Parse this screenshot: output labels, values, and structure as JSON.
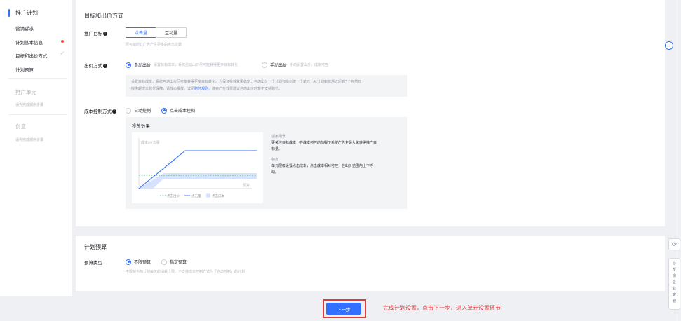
{
  "sidebar": {
    "section1": {
      "title": "推广计划",
      "items": [
        "营销诉求",
        "计划基本信息",
        "目标和出价方式",
        "计划预算"
      ]
    },
    "section2": {
      "title": "推广单元",
      "hint": "请先完成顺序步骤"
    },
    "section3": {
      "title": "创意",
      "hint": "请先完成顺序步骤"
    }
  },
  "objective": {
    "section_title": "目标和出价方式",
    "goal_label": "推广目标",
    "goal_options": [
      "点击量",
      "互动量"
    ],
    "goal_selected": "点击量",
    "goal_hint": "尽可能的让广告产生更多的点击次数",
    "bid_label": "出价方式",
    "bid_options": [
      {
        "label": "自动出价",
        "sub": "设置目标成本，系统自动出价尽可能获得更多目标转化",
        "selected": true
      },
      {
        "label": "手动出价",
        "sub": "手动设置出价，成本可控",
        "selected": false
      }
    ],
    "bid_desc_1": "设置目标成本，系统自动出价尽可能获得更多目标转化。为保证投放效果稳定，自动出价一个计划只能创建一个单元，从计划审核通过起到7个自然日",
    "bid_desc_2a": "提供超成本赔付保障，请放心投放。详见",
    "bid_desc_link": "赔付规则",
    "bid_desc_2b": "。搜索广告效果建议自动出价时暂不支持赔付。",
    "cost_label": "成本控制方式",
    "cost_options": [
      {
        "label": "自动控制",
        "selected": false
      },
      {
        "label": "点击成本控制",
        "selected": true
      }
    ]
  },
  "effect": {
    "title": "投放效果",
    "chart_ylabel": "成本/点击量",
    "chart_xlabel": "预算",
    "legend": [
      "点击出价",
      "点击量",
      "点击成本"
    ],
    "scenario_title": "适用场景",
    "scenario_text_1": "更关注目标成本，在成本可控的前提下希望广告主最大化获得推广目",
    "scenario_text_2": "标量。",
    "feature_title": "特点",
    "feature_text_1": "单元层级设置点击成本，点击成本相对可控，在出价范围内上下浮",
    "feature_text_2": "动。"
  },
  "budget": {
    "section_title": "计划预算",
    "type_label": "预算类型",
    "options": [
      {
        "label": "不限预算",
        "selected": true
      },
      {
        "label": "指定预算",
        "selected": false
      }
    ],
    "hint": "不限制当前计划每天的消耗上限。不支持成本控制方式为「自动控制」的计划"
  },
  "footer": {
    "next_label": "下一步",
    "annotation": "完成计划设置，点击下一步，进入单元设置环节"
  },
  "rail": {
    "tools": [
      "反",
      "馈",
      "企",
      "业",
      "客",
      "服"
    ]
  },
  "colors": {
    "accent": "#3370ff",
    "annotation_red": "#e03a3a",
    "chart_green": "#2fb34b",
    "chart_fill": "#d6e2ff"
  }
}
